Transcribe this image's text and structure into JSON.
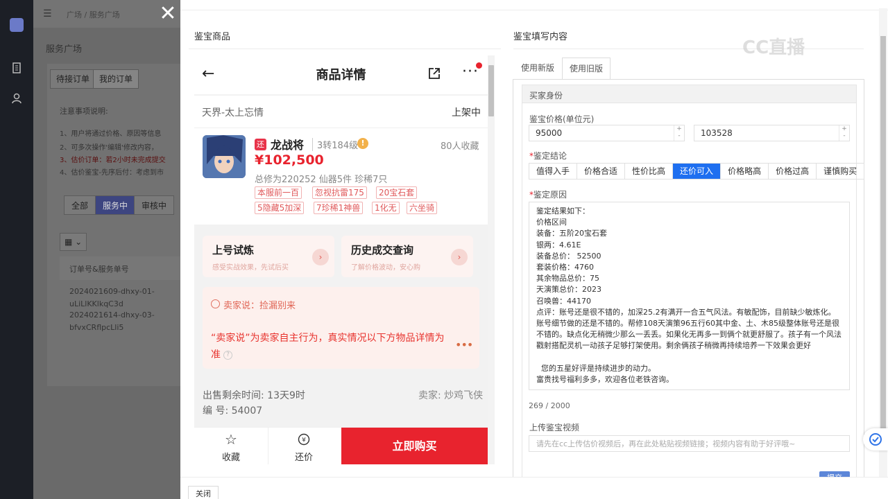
{
  "background": {
    "breadcrumb": "广场 / 服务广场",
    "page_title": "服务广场",
    "tabs": [
      "待接订单",
      "我的订单"
    ],
    "notice_title": "注意事项说明:",
    "notice_lines": [
      "1、用户将通过价格、原因等信息",
      "2、可多次操作'编辑'修改内容，",
      "3、估价订单：若2小时未完成提交",
      "4、估价鉴宝-先序后付：考虑到市"
    ],
    "filters": [
      "全部",
      "服务中",
      "审核中"
    ],
    "view_toggle": "▦ ⌄",
    "table_header": "订单号&服务单号",
    "order_lines": [
      "2024021609-dhxy-01-",
      "uLiLlKKlkqC3d",
      "2024021614-dhxy-03-",
      "bfvxCRflpcLli5"
    ]
  },
  "drawer": {
    "left_title": "鉴宝商品",
    "right_title": "鉴宝填写内容",
    "close_label": "关闭"
  },
  "product": {
    "header_title": "商品详情",
    "server": "天界-太上忘情",
    "status": "上架中",
    "badge": "还",
    "name": "龙战将",
    "level": "3转184级",
    "favorites": "80人收藏",
    "price": "¥102,500",
    "stats": "总修为220252  仙器5件  珍稀7只",
    "tags": [
      "本服前一百",
      "忽视抗雷175",
      "20宝石套",
      "5隐藏5加深",
      "7珍稀1神兽",
      "1化无",
      "六坐骑"
    ],
    "card1_title": "上号试炼",
    "card1_sub": "感受实战效果，先试后买",
    "card2_title": "历史成交查询",
    "card2_sub": "了解价格波动，安心购",
    "seller_title": "卖家说：捡漏别来",
    "seller_text": "“卖家说”为卖家自主行为，真实情况以下方物品详情为准",
    "time_left": "出售剩余时间: 13天9时",
    "seller_name": "卖家: 炒鸡飞侠",
    "serial": "编 号: 54007",
    "collect_label": "收藏",
    "bargain_label": "还价",
    "buy_label": "立即购买"
  },
  "form": {
    "tabs": [
      "使用新版",
      "使用旧版"
    ],
    "active_tab": "使用旧版",
    "section_title": "买家身份",
    "price_label": "鉴宝价格(单位元)",
    "price_min": "95000",
    "price_max": "103528",
    "conclusion_label": "鉴定结论",
    "conclusions": [
      "值得入手",
      "价格合适",
      "性价比高",
      "还价可入",
      "价格略高",
      "价格过高",
      "谨慎购买"
    ],
    "selected_conclusion": "还价可入",
    "reason_label": "鉴定原因",
    "reason_text": "鉴定结果如下：\n价格区间\n装备：五阶20宝石套\n银两：4.61E\n装备总价： 52500\n套装价格：4760\n其余物品总价：75\n天演策总价：2023\n召唤兽：44170\n点评：账号还是很不错的，加深25.2有满开一合五气风法。有敏配饰，目前缺少敏炼化。账号细节做的还是不错的。帮修108天演策96五行60其中金、土、木85级整体账号还是很不错的。缺点化无稍微少那么一丢丢。如果化无再多一到俩个就更舒服了。孩子有一个风法戳射搭配灵机一动孩子足够打架使用。剩余俩孩子稍微再持续培养一下效果会更好\n\n  您的五星好评是持续进步的动力。\n富贵找号福利多多，欢迎各位老铁咨询。",
    "char_count": "269 / 2000",
    "video_label": "上传鉴宝视频",
    "video_placeholder": "请先在cc上传估价视频后，再在此处粘贴视频链接；视频内容有助于好评哦~",
    "submit_label": "提交"
  },
  "watermark": "CC直播",
  "colors": {
    "accent_red": "#e8232e",
    "accent_blue": "#1e6ff0",
    "tag_red": "#e0585a"
  }
}
